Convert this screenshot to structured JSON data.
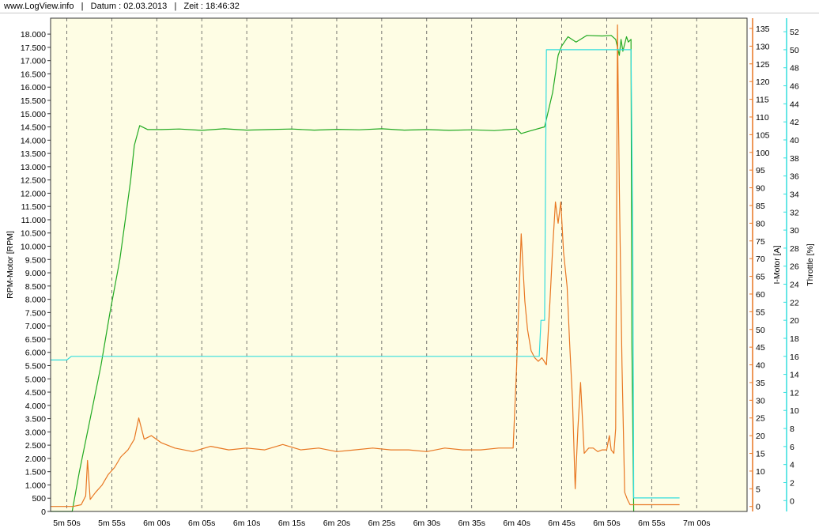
{
  "header": {
    "site": "www.LogView.info",
    "date_label": "Datum : 02.03.2013",
    "time_label": "Zeit : 18:46:32"
  },
  "chart_data": {
    "type": "line",
    "grid": "vertical dashed",
    "background": "#fefde4",
    "x": {
      "unit": "s",
      "range": [
        348.2,
        425.6
      ],
      "tick_values": [
        350,
        355,
        360,
        365,
        370,
        375,
        380,
        385,
        390,
        395,
        400,
        405,
        410,
        415,
        420
      ],
      "tick_labels": [
        "5m 50s",
        "5m 55s",
        "6m 00s",
        "6m 05s",
        "6m 10s",
        "6m 15s",
        "6m 20s",
        "6m 25s",
        "6m 30s",
        "6m 35s",
        "6m 40s",
        "6m 45s",
        "6m 50s",
        "6m 55s",
        "7m 00s"
      ]
    },
    "axes": {
      "left": {
        "label": "RPM-Motor [RPM]",
        "range": [
          0,
          18600
        ],
        "ticks": [
          0,
          500,
          1000,
          1500,
          2000,
          2500,
          3000,
          3500,
          4000,
          4500,
          5000,
          5500,
          6000,
          6500,
          7000,
          7500,
          8000,
          8500,
          9000,
          9500,
          10000,
          10500,
          11000,
          11500,
          12000,
          12500,
          13000,
          13500,
          14000,
          14500,
          15000,
          15500,
          16000,
          16500,
          17000,
          17500,
          18000
        ],
        "tick_labels": [
          "0",
          "500",
          "1.000",
          "1.500",
          "2.000",
          "2.500",
          "3.000",
          "3.500",
          "4.000",
          "4.500",
          "5.000",
          "5.500",
          "6.000",
          "6.500",
          "7.000",
          "7.500",
          "8.000",
          "8.500",
          "9.000",
          "9.500",
          "10.000",
          "10.500",
          "11.000",
          "11.500",
          "12.000",
          "12.500",
          "13.000",
          "13.500",
          "14.000",
          "14.500",
          "15.000",
          "15.500",
          "16.000",
          "16.500",
          "17.000",
          "17.500",
          "18.000"
        ],
        "color": "#22aa22"
      },
      "mid": {
        "label": "I-Motor [A]",
        "range": [
          -1.4,
          137.9
        ],
        "ticks": [
          0,
          5,
          10,
          15,
          20,
          25,
          30,
          35,
          40,
          45,
          50,
          55,
          60,
          65,
          70,
          75,
          80,
          85,
          90,
          95,
          100,
          105,
          110,
          115,
          120,
          125,
          130,
          135
        ],
        "tick_labels": [
          "0",
          "5",
          "10",
          "15",
          "20",
          "25",
          "30",
          "35",
          "40",
          "45",
          "50",
          "55",
          "60",
          "65",
          "70",
          "75",
          "80",
          "85",
          "90",
          "95",
          "100",
          "105",
          "110",
          "115",
          "120",
          "125",
          "130",
          "135"
        ],
        "color": "#e87722"
      },
      "right": {
        "label": "Throttle [%]",
        "range": [
          -1.2,
          53.5
        ],
        "ticks": [
          0,
          2,
          4,
          6,
          8,
          10,
          12,
          14,
          16,
          18,
          20,
          22,
          24,
          26,
          28,
          30,
          32,
          34,
          36,
          38,
          40,
          42,
          44,
          46,
          48,
          50,
          52
        ],
        "tick_labels": [
          "0",
          "2",
          "4",
          "6",
          "8",
          "10",
          "12",
          "14",
          "16",
          "18",
          "20",
          "22",
          "24",
          "26",
          "28",
          "30",
          "32",
          "34",
          "36",
          "38",
          "40",
          "42",
          "44",
          "46",
          "48",
          "50",
          "52"
        ],
        "color": "#33dddd"
      }
    },
    "series": [
      {
        "name": "RPM-Motor",
        "axis": "left",
        "color": "#22aa22",
        "x": [
          348.2,
          350.6,
          351.4,
          352.6,
          353.8,
          354.8,
          355.9,
          356.5,
          357.1,
          357.5,
          358.1,
          359.0,
          360.5,
          362.5,
          365,
          367.5,
          370,
          372.5,
          375,
          377.5,
          380,
          382.5,
          385,
          387.5,
          390,
          392.5,
          395,
          397.5,
          400,
          400.5,
          401.5,
          403.1,
          404.0,
          404.6,
          405.0,
          405.7,
          406.6,
          407.8,
          409.5,
          410.5,
          411.0,
          411.4,
          411.6,
          411.8,
          412.2,
          412.4,
          412.7,
          412.8,
          413.0
        ],
        "y": [
          0,
          0,
          1500,
          3500,
          5500,
          7500,
          9500,
          11000,
          12500,
          13800,
          14550,
          14400,
          14400,
          14420,
          14370,
          14430,
          14380,
          14400,
          14420,
          14380,
          14410,
          14390,
          14430,
          14380,
          14400,
          14370,
          14390,
          14360,
          14420,
          14250,
          14350,
          14500,
          15800,
          17200,
          17550,
          17900,
          17700,
          17950,
          17930,
          17950,
          17800,
          17200,
          17800,
          17350,
          17900,
          17700,
          17800,
          6400,
          0
        ]
      },
      {
        "name": "I-Motor",
        "axis": "mid",
        "color": "#e87722",
        "x": [
          348.2,
          350.7,
          351.6,
          352.1,
          352.3,
          352.6,
          353.2,
          353.9,
          354.6,
          355.3,
          356.0,
          356.8,
          357.5,
          358.0,
          358.6,
          359.4,
          360.5,
          362,
          364,
          366,
          368,
          370,
          372,
          374,
          376,
          378,
          380,
          382,
          384,
          386,
          388,
          390,
          392,
          394,
          396,
          398,
          399.6,
          400.0,
          400.5,
          400.9,
          401.2,
          401.6,
          402.0,
          402.4,
          402.8,
          403.3,
          403.7,
          404.0,
          404.3,
          404.6,
          404.9,
          405.2,
          405.6,
          405.9,
          406.2,
          406.5,
          406.8,
          407.1,
          407.5,
          408.0,
          408.5,
          409.0,
          409.5,
          410.0,
          410.3,
          410.5,
          410.8,
          411.0,
          411.2,
          411.4,
          411.7,
          412.0,
          412.3,
          412.6,
          412.9,
          413.2,
          413.5,
          418.1
        ],
        "y": [
          0,
          0,
          0.5,
          3,
          13,
          2,
          4,
          6,
          9,
          11,
          14,
          16,
          19,
          25,
          19,
          20,
          18,
          16.5,
          15.5,
          17,
          16,
          16.5,
          16,
          17.5,
          16,
          16.5,
          15.5,
          16,
          16.5,
          16,
          16,
          15.5,
          16.5,
          16,
          16,
          16.5,
          16.5,
          40,
          77,
          58,
          50,
          44,
          42,
          41,
          42,
          40,
          58,
          73,
          86,
          80,
          86,
          72,
          62,
          45,
          30,
          5,
          22,
          35,
          15,
          16.5,
          16.5,
          15.5,
          16,
          16,
          20,
          16,
          15,
          22,
          136,
          90,
          40,
          4,
          2,
          0.5,
          0.5,
          0.5,
          0.5,
          0.5
        ]
      },
      {
        "name": "Throttle",
        "axis": "right",
        "color": "#33dddd",
        "x": [
          348.2,
          350.0,
          350.5,
          400.0,
          402.5,
          402.7,
          403.1,
          403.3,
          408.0,
          410.0,
          412.7,
          412.9,
          413.0,
          418.1
        ],
        "y": [
          15.6,
          15.6,
          16.0,
          16.0,
          16.0,
          20.0,
          20.0,
          50.0,
          50.0,
          50.0,
          50.0,
          30.0,
          0.3,
          0.3
        ]
      }
    ]
  }
}
